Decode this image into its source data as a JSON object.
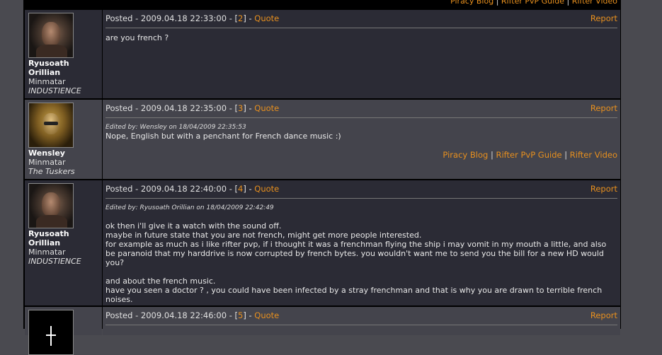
{
  "signature": {
    "links": [
      "Piracy Blog",
      "Rifter PvP Guide",
      "Rifter Video"
    ],
    "separator": "|"
  },
  "posts": [
    {
      "author": {
        "name": "Ryusoath Orillian",
        "race": "Minmatar",
        "corp": "INDUSTIENCE",
        "avatar": "ryusoath-avatar"
      },
      "posted_prefix": "Posted - 2009.04.18 22:33:00 - [",
      "num": "2",
      "posted_suffix": "] - ",
      "quote": "Quote",
      "report": "Report",
      "edited": "",
      "lines": [
        "are you french ?"
      ]
    },
    {
      "author": {
        "name": "Wensley",
        "race": "Minmatar",
        "corp": "The Tuskers",
        "avatar": "wensley-avatar"
      },
      "posted_prefix": "Posted - 2009.04.18 22:35:00 - [",
      "num": "3",
      "posted_suffix": "] - ",
      "quote": "Quote",
      "report": "Report",
      "edited": "Edited by: Wensley on 18/04/2009 22:35:53",
      "lines": [
        "Nope, English but with a penchant for French dance music :)"
      ]
    },
    {
      "author": {
        "name": "Ryusoath Orillian",
        "race": "Minmatar",
        "corp": "INDUSTIENCE",
        "avatar": "ryusoath-avatar"
      },
      "posted_prefix": "Posted - 2009.04.18 22:40:00 - [",
      "num": "4",
      "posted_suffix": "] - ",
      "quote": "Quote",
      "report": "Report",
      "edited": "Edited by: Ryusoath Orillian on 18/04/2009 22:42:49",
      "lines": [
        "ok then i'll give it a watch with the sound off.",
        "maybe in future state that you are not french, might get more people interested.",
        "for example as much as i like rifter pvp, if i thought it was a frenchman flying the ship i may vomit in my mouth a little, and also be paranoid that my harddrive is now corrupted by french bytes. you wouldn't want me to send you the bill for a new HD would you?",
        "",
        "and about the french music.",
        "have you seen a doctor ? , you could have been infected by a stray frenchman and that is why you are drawn to terrible french noises."
      ]
    },
    {
      "author": {
        "name": "",
        "race": "",
        "corp": "",
        "avatar": "black-avatar"
      },
      "posted_prefix": "Posted - 2009.04.18 22:46:00 - [",
      "num": "5",
      "posted_suffix": "] - ",
      "quote": "Quote",
      "report": "Report",
      "edited": "",
      "lines": []
    }
  ]
}
